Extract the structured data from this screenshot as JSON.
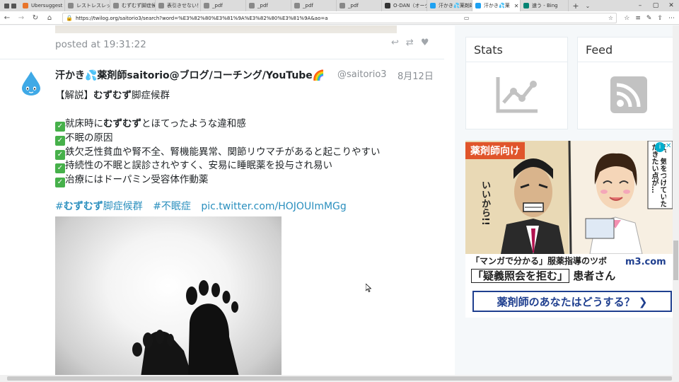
{
  "browser": {
    "tabs": [
      {
        "label": "Ubersuggest",
        "color": "#e8742a",
        "active": false
      },
      {
        "label": "レストレスレッグス症",
        "color": "#888888",
        "active": false
      },
      {
        "label": "むずむず脚症候群",
        "color": "#888888",
        "active": false
      },
      {
        "label": "表引きせない！",
        "color": "#888888",
        "active": false
      },
      {
        "label": "_pdf",
        "color": "#888888",
        "active": false
      },
      {
        "label": "_pdf",
        "color": "#888888",
        "active": false
      },
      {
        "label": "_pdf",
        "color": "#888888",
        "active": false
      },
      {
        "label": "_pdf",
        "color": "#888888",
        "active": false
      },
      {
        "label": "O-DAN（オーダン）",
        "color": "#333333",
        "active": false
      },
      {
        "label": "汗かき💦薬剤師",
        "color": "#1da1f2",
        "active": false
      },
      {
        "label": "汗かき💦薬",
        "color": "#1da1f2",
        "active": true
      },
      {
        "label": "速う - Bing",
        "color": "#008373",
        "active": false
      }
    ],
    "url": "https://twilog.org/saitorio3/search?word=%E3%82%80%E3%81%9A%E3%82%80%E3%81%9A&ao=a"
  },
  "prev_tweet": {
    "posted_label": "posted at 19:31:22"
  },
  "tweet": {
    "username": "汗かき💦薬剤師saitorio@ブログ/コーチング/YouTube🌈",
    "handle": "@saitorio3",
    "date": "8月12日",
    "title_prefix": "【解説】",
    "title_bold": "むずむず",
    "title_suffix": "脚症候群",
    "line1_prefix": "就床時に",
    "line1_bold": "むずむず",
    "line1_suffix": "とほてったような違和感",
    "line2": "不眠の原因",
    "line3": "鉄欠乏性貧血や腎不全、腎機能異常、関節リウマチがあると起こりやすい",
    "line4": "持続性の不眠と誤診されやすく、安易に睡眠薬を投与され易い",
    "line5": "治療にはドーパミン受容体作動薬",
    "hashtag1_prefix": "#",
    "hashtag1_bold": "むずむず",
    "hashtag1_suffix": "脚症候群",
    "hashtag2": "#不眠症",
    "pic_link": "pic.twitter.com/HOJOUImMGg"
  },
  "sidebar": {
    "stats_title": "Stats",
    "feed_title": "Feed"
  },
  "ad": {
    "badge": "薬剤師向け",
    "speech_left": "いいから!!",
    "speech_right": "え、気をつけていただきたい点が…",
    "tagline": "「マンガで分かる」服薬指導のツボ",
    "headline_q": "「疑義照会を拒む」",
    "headline_rest": "患者さん",
    "brand": "m3.com",
    "cta": "薬剤師のあなたはどうする？ ❯"
  }
}
